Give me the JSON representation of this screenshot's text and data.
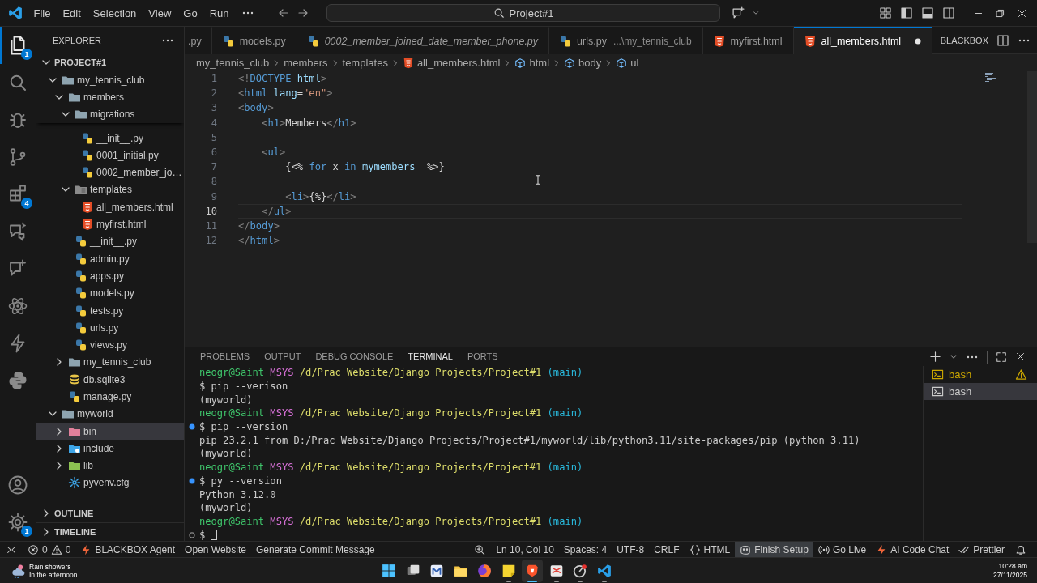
{
  "titlebar": {
    "menu": [
      "File",
      "Edit",
      "Selection",
      "View",
      "Go",
      "Run"
    ],
    "search": "Project#1"
  },
  "activity": {
    "top": [
      {
        "kind": "files",
        "selected": true,
        "badge": "1"
      },
      {
        "kind": "search",
        "selected": false
      },
      {
        "kind": "debug",
        "selected": false
      },
      {
        "kind": "git",
        "selected": false
      },
      {
        "kind": "extensions",
        "selected": false,
        "badge": "4"
      },
      {
        "kind": "chat-remote",
        "selected": false
      },
      {
        "kind": "chat-sparkle",
        "selected": false
      },
      {
        "kind": "atom",
        "selected": false
      },
      {
        "kind": "bolt",
        "selected": false
      },
      {
        "kind": "python-logo",
        "selected": false
      }
    ],
    "bottom": [
      {
        "kind": "account",
        "selected": false
      },
      {
        "kind": "gear",
        "selected": false,
        "badge": "1"
      }
    ]
  },
  "sidebar": {
    "title": "EXPLORER",
    "section": {
      "label": "PROJECT#1",
      "expanded": true
    },
    "tree": [
      {
        "label": "my_tennis_club",
        "kind": "folder",
        "expanded": true,
        "selected": false,
        "children": [
          {
            "label": "members",
            "kind": "folder",
            "expanded": true,
            "selected": false,
            "children": [
              {
                "label": "migrations",
                "kind": "folder",
                "expanded": true,
                "selected": false,
                "children": [
                  {
                    "label": "__init__.py",
                    "kind": "python",
                    "selected": false
                  },
                  {
                    "label": "0001_initial.py",
                    "kind": "python",
                    "selected": false
                  },
                  {
                    "label": "0002_member_jo…",
                    "kind": "python",
                    "selected": false
                  }
                ]
              },
              {
                "label": "templates",
                "kind": "folder-templates",
                "expanded": true,
                "selected": false,
                "children": [
                  {
                    "label": "all_members.html",
                    "kind": "html",
                    "selected": false
                  },
                  {
                    "label": "myfirst.html",
                    "kind": "html",
                    "selected": false
                  }
                ]
              },
              {
                "label": "__init__.py",
                "kind": "python",
                "selected": false
              },
              {
                "label": "admin.py",
                "kind": "python",
                "selected": false
              },
              {
                "label": "apps.py",
                "kind": "python",
                "selected": false
              },
              {
                "label": "models.py",
                "kind": "python",
                "selected": false
              },
              {
                "label": "tests.py",
                "kind": "python",
                "selected": false
              },
              {
                "label": "urls.py",
                "kind": "python",
                "selected": false
              },
              {
                "label": "views.py",
                "kind": "python",
                "selected": false
              }
            ]
          },
          {
            "label": "my_tennis_club",
            "kind": "folder",
            "expanded": false,
            "selected": false
          },
          {
            "label": "db.sqlite3",
            "kind": "database",
            "selected": false
          },
          {
            "label": "manage.py",
            "kind": "python",
            "selected": false
          }
        ]
      },
      {
        "label": "myworld",
        "kind": "folder",
        "expanded": true,
        "selected": false,
        "children": [
          {
            "label": "bin",
            "kind": "folder-bin",
            "expanded": false,
            "selected": true
          },
          {
            "label": "include",
            "kind": "folder-include",
            "expanded": false,
            "selected": false
          },
          {
            "label": "lib",
            "kind": "folder-lib",
            "expanded": false,
            "selected": false
          },
          {
            "label": "pyvenv.cfg",
            "kind": "config",
            "selected": false
          }
        ]
      }
    ],
    "bottom_sections": [
      {
        "label": "OUTLINE",
        "expanded": false
      },
      {
        "label": "TIMELINE",
        "expanded": false
      }
    ]
  },
  "editor": {
    "tabs": [
      {
        "label": ".py",
        "kind": "plain",
        "preview": false,
        "selected": false,
        "modified": false
      },
      {
        "label": "models.py",
        "kind": "python",
        "preview": false,
        "selected": false,
        "modified": false
      },
      {
        "label": "0002_member_joined_date_member_phone.py",
        "kind": "python",
        "preview": true,
        "selected": false,
        "modified": false
      },
      {
        "label": "urls.py",
        "description": "...\\my_tennis_club",
        "kind": "python",
        "preview": false,
        "selected": false,
        "modified": false
      },
      {
        "label": "myfirst.html",
        "kind": "html",
        "preview": false,
        "selected": false,
        "modified": false
      },
      {
        "label": "all_members.html",
        "kind": "html",
        "preview": false,
        "selected": true,
        "modified": true
      }
    ],
    "tab_actions_label": "BLACKBOX",
    "breadcrumbs": [
      {
        "label": "my_tennis_club",
        "kind": "plain"
      },
      {
        "label": "members",
        "kind": "plain"
      },
      {
        "label": "templates",
        "kind": "plain"
      },
      {
        "label": "all_members.html",
        "kind": "html"
      },
      {
        "label": "html",
        "kind": "symbol"
      },
      {
        "label": "body",
        "kind": "symbol"
      },
      {
        "label": "ul",
        "kind": "symbol"
      }
    ],
    "code": [
      {
        "number": "1",
        "current": false,
        "tokens": [
          {
            "text": "<!",
            "kind": "punct"
          },
          {
            "text": "DOCTYPE",
            "kind": "tag"
          },
          {
            "text": " html",
            "kind": "attr"
          },
          {
            "text": ">",
            "kind": "punct"
          }
        ]
      },
      {
        "number": "2",
        "current": false,
        "tokens": [
          {
            "text": "<",
            "kind": "punct"
          },
          {
            "text": "html",
            "kind": "tag"
          },
          {
            "text": " lang",
            "kind": "attr"
          },
          {
            "text": "=",
            "kind": "text"
          },
          {
            "text": "\"en\"",
            "kind": "string"
          },
          {
            "text": ">",
            "kind": "punct"
          }
        ]
      },
      {
        "number": "3",
        "current": false,
        "tokens": [
          {
            "text": "<",
            "kind": "punct"
          },
          {
            "text": "body",
            "kind": "tag"
          },
          {
            "text": ">",
            "kind": "punct"
          }
        ]
      },
      {
        "number": "4",
        "current": false,
        "tokens": [
          {
            "text": "    <",
            "kind": "punct"
          },
          {
            "text": "h1",
            "kind": "tag"
          },
          {
            "text": ">",
            "kind": "punct"
          },
          {
            "text": "Members",
            "kind": "text"
          },
          {
            "text": "</",
            "kind": "punct"
          },
          {
            "text": "h1",
            "kind": "tag"
          },
          {
            "text": ">",
            "kind": "punct"
          }
        ]
      },
      {
        "number": "5",
        "current": false
      },
      {
        "number": "6",
        "current": false,
        "tokens": [
          {
            "text": "    <",
            "kind": "punct"
          },
          {
            "text": "ul",
            "kind": "tag"
          },
          {
            "text": ">",
            "kind": "punct"
          }
        ]
      },
      {
        "number": "7",
        "current": false,
        "tokens": [
          {
            "text": "        {<% ",
            "kind": "text"
          },
          {
            "text": "for",
            "kind": "keyword"
          },
          {
            "text": " x ",
            "kind": "text"
          },
          {
            "text": "in ",
            "kind": "keyword"
          },
          {
            "text": "mymembers",
            "kind": "variable"
          },
          {
            "text": "  %>}",
            "kind": "text"
          }
        ]
      },
      {
        "number": "8",
        "current": false
      },
      {
        "number": "9",
        "current": false,
        "tokens": [
          {
            "text": "        <",
            "kind": "punct"
          },
          {
            "text": "li",
            "kind": "tag"
          },
          {
            "text": ">",
            "kind": "punct"
          },
          {
            "text": "{%}",
            "kind": "text"
          },
          {
            "text": "</",
            "kind": "punct"
          },
          {
            "text": "li",
            "kind": "tag"
          },
          {
            "text": ">",
            "kind": "punct"
          }
        ]
      },
      {
        "number": "10",
        "current": true,
        "tokens": [
          {
            "text": "    </",
            "kind": "punct"
          },
          {
            "text": "ul",
            "kind": "tag"
          },
          {
            "text": ">",
            "kind": "punct"
          }
        ]
      },
      {
        "number": "11",
        "current": false,
        "tokens": [
          {
            "text": "</",
            "kind": "punct"
          },
          {
            "text": "body",
            "kind": "tag"
          },
          {
            "text": ">",
            "kind": "punct"
          }
        ]
      },
      {
        "number": "12",
        "current": false,
        "tokens": [
          {
            "text": "</",
            "kind": "punct"
          },
          {
            "text": "html",
            "kind": "tag"
          },
          {
            "text": ">",
            "kind": "punct"
          }
        ]
      }
    ]
  },
  "panel": {
    "tabs": [
      {
        "label": "PROBLEMS",
        "selected": false
      },
      {
        "label": "OUTPUT",
        "selected": false
      },
      {
        "label": "DEBUG CONSOLE",
        "selected": false
      },
      {
        "label": "TERMINAL",
        "selected": true
      },
      {
        "label": "PORTS",
        "selected": false
      }
    ],
    "terminal": {
      "lines": [
        {
          "kind": "plain",
          "segments": [
            {
              "text": "neogr@Saint",
              "kind": "user"
            },
            {
              "text": " MSYS ",
              "kind": "shell"
            },
            {
              "text": "/d/Prac Website/Django Projects/Project#1",
              "kind": "path"
            },
            {
              "text": " (main)",
              "kind": "branch"
            }
          ]
        },
        {
          "kind": "plain",
          "segments": [
            {
              "text": "$ pip --verison",
              "kind": "plain"
            }
          ]
        },
        {
          "kind": "plain",
          "segments": [
            {
              "text": "(myworld)",
              "kind": "plain"
            }
          ]
        },
        {
          "kind": "plain",
          "segments": [
            {
              "text": "neogr@Saint",
              "kind": "user"
            },
            {
              "text": " MSYS ",
              "kind": "shell"
            },
            {
              "text": "/d/Prac Website/Django Projects/Project#1",
              "kind": "path"
            },
            {
              "text": " (main)",
              "kind": "branch"
            }
          ]
        },
        {
          "kind": "success",
          "segments": [
            {
              "text": "$ pip --version",
              "kind": "plain"
            }
          ]
        },
        {
          "kind": "plain",
          "segments": [
            {
              "text": "pip 23.2.1 from D:/Prac Website/Django Projects/Project#1/myworld/lib/python3.11/site-packages/pip (python 3.11)",
              "kind": "plain"
            }
          ]
        },
        {
          "kind": "plain",
          "segments": [
            {
              "text": "(myworld)",
              "kind": "plain"
            }
          ]
        },
        {
          "kind": "plain",
          "segments": [
            {
              "text": "neogr@Saint",
              "kind": "user"
            },
            {
              "text": " MSYS ",
              "kind": "shell"
            },
            {
              "text": "/d/Prac Website/Django Projects/Project#1",
              "kind": "path"
            },
            {
              "text": " (main)",
              "kind": "branch"
            }
          ]
        },
        {
          "kind": "success",
          "segments": [
            {
              "text": "$ py --version",
              "kind": "plain"
            }
          ]
        },
        {
          "kind": "plain",
          "segments": [
            {
              "text": "Python 3.12.0",
              "kind": "plain"
            }
          ]
        },
        {
          "kind": "plain",
          "segments": [
            {
              "text": "(myworld)",
              "kind": "plain"
            }
          ]
        },
        {
          "kind": "plain",
          "segments": [
            {
              "text": "neogr@Saint",
              "kind": "user"
            },
            {
              "text": " MSYS ",
              "kind": "shell"
            },
            {
              "text": "/d/Prac Website/Django Projects/Project#1",
              "kind": "path"
            },
            {
              "text": " (main)",
              "kind": "branch"
            }
          ]
        },
        {
          "kind": "pending",
          "segments": [
            {
              "text": "$",
              "kind": "plain"
            }
          ]
        }
      ],
      "sessions": [
        {
          "label": "bash",
          "warning": true,
          "selected": false
        },
        {
          "label": "bash",
          "warning": false,
          "selected": true
        }
      ]
    }
  },
  "status": {
    "left": [
      {
        "kind": "remote"
      },
      {
        "kind": "problems",
        "errors": "0",
        "warnings": "0"
      },
      {
        "kind": "bolt",
        "text": "BLACKBOX Agent",
        "highlighted": false
      },
      {
        "kind": "plain",
        "text": "Open Website",
        "highlighted": false
      },
      {
        "kind": "plain",
        "text": "Generate Commit Message",
        "highlighted": false
      }
    ],
    "right": [
      {
        "kind": "zoom"
      },
      {
        "kind": "plain",
        "text": "Ln 10, Col 10",
        "highlighted": false
      },
      {
        "kind": "plain",
        "text": "Spaces: 4",
        "highlighted": false
      },
      {
        "kind": "plain",
        "text": "UTF-8",
        "highlighted": false
      },
      {
        "kind": "plain",
        "text": "CRLF",
        "highlighted": false
      },
      {
        "kind": "braces",
        "text": "HTML",
        "highlighted": false
      },
      {
        "kind": "copilot",
        "text": "Finish Setup",
        "highlighted": true
      },
      {
        "kind": "broadcast",
        "text": "Go Live",
        "highlighted": false
      },
      {
        "kind": "bolt",
        "text": "AI Code Chat",
        "highlighted": false
      },
      {
        "kind": "check-double",
        "text": "Prettier",
        "highlighted": false
      },
      {
        "kind": "bell"
      }
    ]
  },
  "taskbar": {
    "weather": {
      "title": "Rain showers",
      "subtitle": "In the afternoon"
    },
    "apps": [
      {
        "kind": "windows",
        "running": false,
        "active": false
      },
      {
        "kind": "task-view",
        "running": false,
        "active": false
      },
      {
        "kind": "m-app",
        "running": false,
        "active": false
      },
      {
        "kind": "file-folder",
        "running": false,
        "active": false
      },
      {
        "kind": "fox-browser",
        "running": false,
        "active": false
      },
      {
        "kind": "sticky-note",
        "running": true,
        "active": false
      },
      {
        "kind": "lion-browser",
        "running": true,
        "active": true
      },
      {
        "kind": "snip-tool",
        "running": true,
        "active": false
      },
      {
        "kind": "circle-app",
        "running": true,
        "active": false
      },
      {
        "kind": "code-editor",
        "running": true,
        "active": false
      }
    ],
    "time": "10:28 am",
    "date": "27/11/2025"
  }
}
